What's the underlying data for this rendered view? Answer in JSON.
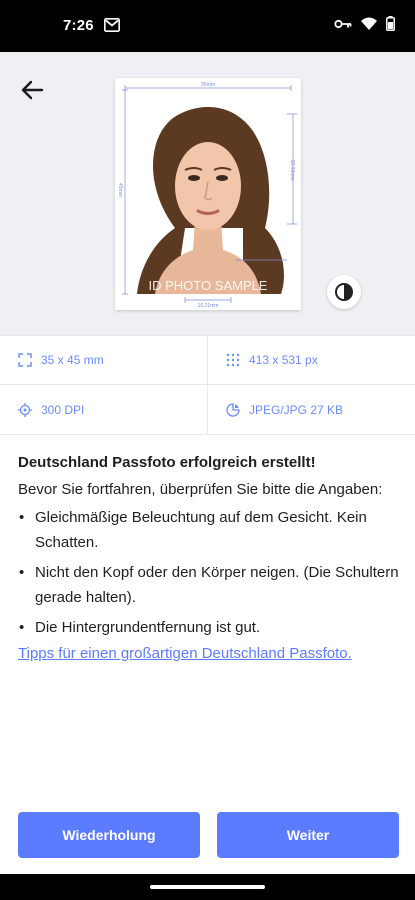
{
  "status_bar": {
    "time": "7:26"
  },
  "photo": {
    "sample_label": "ID PHOTO SAMPLE",
    "dim_width": "35mm",
    "dim_height": "45mm",
    "dim_head": "32-36mm",
    "dim_bottom": "10.21mm"
  },
  "specs": [
    {
      "icon": "dimensions-icon",
      "label": "35 x 45 mm"
    },
    {
      "icon": "pixels-grid-icon",
      "label": "413 x 531 px"
    },
    {
      "icon": "dpi-icon",
      "label": "300 DPI"
    },
    {
      "icon": "file-size-icon",
      "label": "JPEG/JPG 27 KB"
    }
  ],
  "content": {
    "heading": "Deutschland Passfoto erfolgreich erstellt!",
    "intro": "Bevor Sie fortfahren, überprüfen Sie bitte die Angaben:",
    "bullets": [
      "Gleichmäßige Beleuchtung auf dem Gesicht. Kein Schatten.",
      "Nicht den Kopf oder den Körper neigen. (Die Schultern gerade halten).",
      "Die Hintergrundentfernung ist gut."
    ],
    "bullet_char": "•",
    "link": "Tipps für einen großartigen Deutschland Passfoto."
  },
  "buttons": {
    "retake": "Wiederholung",
    "continue": "Weiter"
  },
  "colors": {
    "accent": "#5b7cff",
    "preview_bg": "#eef0f3",
    "spec_text": "#6b8cff"
  }
}
